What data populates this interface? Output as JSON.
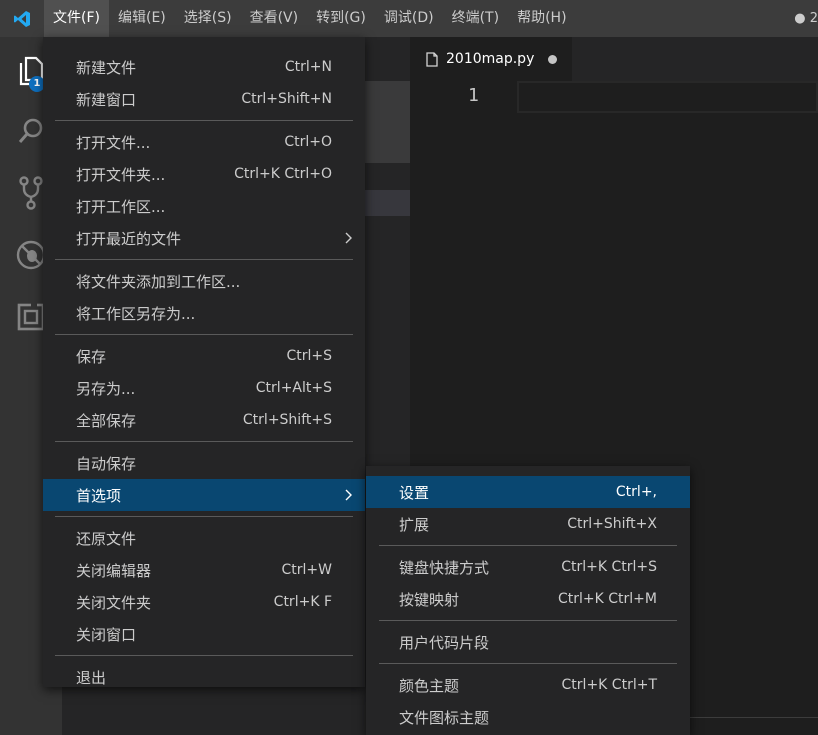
{
  "menubar": {
    "items": [
      "文件(F)",
      "编辑(E)",
      "选择(S)",
      "查看(V)",
      "转到(G)",
      "调试(D)",
      "终端(T)",
      "帮助(H)"
    ],
    "title_fragment": "● 2"
  },
  "activitybar": {
    "explorer_badge": "1",
    "icons": [
      "explorer-icon",
      "search-icon",
      "source-control-icon",
      "debug-icon",
      "extensions-icon"
    ]
  },
  "editor": {
    "tab_label": "2010map.py",
    "line_number": "1"
  },
  "file_menu": {
    "groups": [
      [
        {
          "label": "新建文件",
          "key": "Ctrl+N"
        },
        {
          "label": "新建窗口",
          "key": "Ctrl+Shift+N"
        }
      ],
      [
        {
          "label": "打开文件...",
          "key": "Ctrl+O"
        },
        {
          "label": "打开文件夹...",
          "key": "Ctrl+K Ctrl+O"
        },
        {
          "label": "打开工作区...",
          "key": ""
        },
        {
          "label": "打开最近的文件",
          "key": "",
          "submenu": true
        }
      ],
      [
        {
          "label": "将文件夹添加到工作区...",
          "key": ""
        },
        {
          "label": "将工作区另存为...",
          "key": ""
        }
      ],
      [
        {
          "label": "保存",
          "key": "Ctrl+S"
        },
        {
          "label": "另存为...",
          "key": "Ctrl+Alt+S"
        },
        {
          "label": "全部保存",
          "key": "Ctrl+Shift+S"
        }
      ],
      [
        {
          "label": "自动保存",
          "key": ""
        },
        {
          "label": "首选项",
          "key": "",
          "submenu": true,
          "highlight": true
        }
      ],
      [
        {
          "label": "还原文件",
          "key": ""
        },
        {
          "label": "关闭编辑器",
          "key": "Ctrl+W"
        },
        {
          "label": "关闭文件夹",
          "key": "Ctrl+K F"
        },
        {
          "label": "关闭窗口",
          "key": ""
        }
      ],
      [
        {
          "label": "退出",
          "key": ""
        }
      ]
    ]
  },
  "preferences_menu": {
    "groups": [
      [
        {
          "label": "设置",
          "key": "Ctrl+,",
          "highlight": true
        },
        {
          "label": "扩展",
          "key": "Ctrl+Shift+X"
        }
      ],
      [
        {
          "label": "键盘快捷方式",
          "key": "Ctrl+K Ctrl+S"
        },
        {
          "label": "按键映射",
          "key": "Ctrl+K Ctrl+M"
        }
      ],
      [
        {
          "label": "用户代码片段",
          "key": ""
        }
      ],
      [
        {
          "label": "颜色主题",
          "key": "Ctrl+K Ctrl+T"
        },
        {
          "label": "文件图标主题",
          "key": ""
        }
      ]
    ]
  },
  "colors": {
    "highlight": "#094771",
    "accent_blue": "#0e70c0",
    "logo_blue": "#23a9f2"
  }
}
